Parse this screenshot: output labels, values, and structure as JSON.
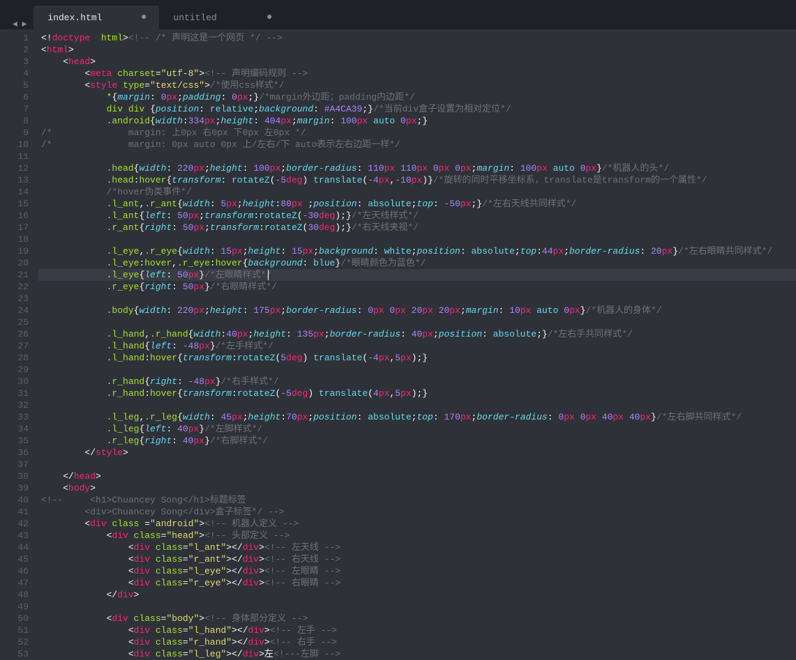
{
  "tabs": [
    {
      "label": "index.html",
      "active": true,
      "dirty": true
    },
    {
      "label": "untitled",
      "active": false,
      "dirty": true
    }
  ],
  "nav": {
    "back": "◄",
    "fwd": "►"
  },
  "line_count": 53,
  "active_line": 21,
  "code_lines": [
    "<span class='pun'>&lt;!</span><span class='kw'>doctype</span><span class='pun'>  </span><span class='attr'>html</span><span class='pun'>&gt;</span><span class='cmt'>&lt;!-- /* 声明这是一个网页 */ --&gt;</span>",
    "<span class='pun'>&lt;</span><span class='tag'>html</span><span class='pun'>&gt;</span>",
    "    <span class='pun'>&lt;</span><span class='tag'>head</span><span class='pun'>&gt;</span>",
    "        <span class='pun'>&lt;</span><span class='tag'>meta</span> <span class='attr'>charset</span><span class='pun'>=</span><span class='str'>\"utf-8\"</span><span class='pun'>&gt;</span><span class='cmt'>&lt;!-- 声明编码规则 --&gt;</span>",
    "        <span class='pun'>&lt;</span><span class='tag'>style</span> <span class='attr'>type</span><span class='pun'>=</span><span class='str'>\"text/css\"</span><span class='pun'>&gt;</span><span class='cmt'>/*使用css样式*/</span>",
    "            <span class='sel'>*</span><span class='pun'>{</span><span class='prop'>margin</span><span class='pun'>: </span><span class='num'>0</span><span class='unit'>px</span><span class='pun'>;</span><span class='prop'>padding</span><span class='pun'>: </span><span class='num'>0</span><span class='unit'>px</span><span class='pun'>;}</span><span class='cmt'>/*margin外边距；padding内边距*/</span>",
    "            <span class='sel'>div</span> <span class='sel'>div</span> <span class='pun'>{</span><span class='prop'>position</span><span class='pun'>: </span><span class='val'>relative</span><span class='pun'>;</span><span class='prop'>background</span><span class='pun'>: </span><span class='hex'>#A4CA39</span><span class='pun'>;}</span><span class='cmt'>/*当前div盒子设置为相对定位*/</span>",
    "            <span class='sel'>.android</span><span class='pun'>{</span><span class='prop'>width</span><span class='pun'>:</span><span class='num'>334</span><span class='unit'>px</span><span class='pun'>;</span><span class='prop'>height</span><span class='pun'>: </span><span class='num'>404</span><span class='unit'>px</span><span class='pun'>;</span><span class='prop'>margin</span><span class='pun'>: </span><span class='num'>100</span><span class='unit'>px</span> <span class='val'>auto</span> <span class='num'>0</span><span class='unit'>px</span><span class='pun'>;}</span>",
    "<span class='cmt'>/*              margin: 上0px 右0px 下0px 左0px */</span>",
    "<span class='cmt'>/*              margin: 0px auto 0px 上/左右/下 auto表示左右边距一样*/</span>",
    "",
    "            <span class='sel'>.head</span><span class='pun'>{</span><span class='prop'>width</span><span class='pun'>: </span><span class='num'>220</span><span class='unit'>px</span><span class='pun'>;</span><span class='prop'>height</span><span class='pun'>: </span><span class='num'>100</span><span class='unit'>px</span><span class='pun'>;</span><span class='prop'>border-radius</span><span class='pun'>: </span><span class='num'>110</span><span class='unit'>px</span> <span class='num'>110</span><span class='unit'>px</span> <span class='num'>0</span><span class='unit'>px</span> <span class='num'>0</span><span class='unit'>px</span><span class='pun'>;</span><span class='prop'>margin</span><span class='pun'>: </span><span class='num'>100</span><span class='unit'>px</span> <span class='val'>auto</span> <span class='num'>0</span><span class='unit'>px</span><span class='pun'>}</span><span class='cmt'>/*机器人的头*/</span>",
    "            <span class='sel'>.head</span><span class='pun'>:</span><span class='sel'>hover</span><span class='pun'>{</span><span class='prop'>transform</span><span class='pun'>: </span><span class='fn'>rotateZ</span><span class='pun'>(</span><span class='num'>-5</span><span class='unit'>deg</span><span class='pun'>) </span><span class='fn'>translate</span><span class='pun'>(</span><span class='num'>-4</span><span class='unit'>px</span><span class='pun'>,</span><span class='num'>-10</span><span class='unit'>px</span><span class='pun'>)}</span><span class='cmt'>/*旋转的同时平移坐标系，translate是transform的一个属性*/</span>",
    "            <span class='cmt'>/*hover伪类事件*/</span>",
    "            <span class='sel'>.l_ant</span><span class='pun'>,</span><span class='sel'>.r_ant</span><span class='pun'>{</span><span class='prop'>width</span><span class='pun'>: </span><span class='num'>5</span><span class='unit'>px</span><span class='pun'>;</span><span class='prop'>height</span><span class='pun'>:</span><span class='num'>80</span><span class='unit'>px</span> <span class='pun'>;</span><span class='prop'>position</span><span class='pun'>: </span><span class='val'>absolute</span><span class='pun'>;</span><span class='prop'>top</span><span class='pun'>: </span><span class='num'>-50</span><span class='unit'>px</span><span class='pun'>;}</span><span class='cmt'>/*左右天线共同样式*/</span>",
    "            <span class='sel'>.l_ant</span><span class='pun'>{</span><span class='prop'>left</span><span class='pun'>: </span><span class='num'>50</span><span class='unit'>px</span><span class='pun'>;</span><span class='prop'>transform</span><span class='pun'>:</span><span class='fn'>rotateZ</span><span class='pun'>(</span><span class='num'>-30</span><span class='unit'>deg</span><span class='pun'>);}</span><span class='cmt'>/*左天线样式*/</span>",
    "            <span class='sel'>.r_ant</span><span class='pun'>{</span><span class='prop'>right</span><span class='pun'>: </span><span class='num'>50</span><span class='unit'>px</span><span class='pun'>;</span><span class='prop'>transform</span><span class='pun'>:</span><span class='fn'>rotateZ</span><span class='pun'>(</span><span class='num'>30</span><span class='unit'>deg</span><span class='pun'>);}</span><span class='cmt'>/*右天线夹视*/</span>",
    "",
    "            <span class='sel'>.l_eye</span><span class='pun'>,</span><span class='sel'>.r_eye</span><span class='pun'>{</span><span class='prop'>width</span><span class='pun'>: </span><span class='num'>15</span><span class='unit'>px</span><span class='pun'>;</span><span class='prop'>height</span><span class='pun'>: </span><span class='num'>15</span><span class='unit'>px</span><span class='pun'>;</span><span class='prop'>background</span><span class='pun'>: </span><span class='val'>white</span><span class='pun'>;</span><span class='prop'>position</span><span class='pun'>: </span><span class='val'>absolute</span><span class='pun'>;</span><span class='prop'>top</span><span class='pun'>:</span><span class='num'>44</span><span class='unit'>px</span><span class='pun'>;</span><span class='prop'>border-radius</span><span class='pun'>: </span><span class='num'>20</span><span class='unit'>px</span><span class='pun'>}</span><span class='cmt'>/*左右眼睛共同样式*/</span>",
    "            <span class='sel'>.l_eye</span><span class='pun'>:</span><span class='sel'>hover</span><span class='pun'>,</span><span class='sel'>.r_eye</span><span class='pun'>:</span><span class='sel'>hover</span><span class='pun'>{</span><span class='prop'>background</span><span class='pun'>: </span><span class='val'>blue</span><span class='pun'>}</span><span class='cmt'>/*眼睛颜色为蓝色*/</span>",
    "            <span class='sel'>.l_eye</span><span class='pun'>{</span><span class='prop'>left</span><span class='pun'>: </span><span class='num'>50</span><span class='unit'>px</span><span class='pun'>}</span><span class='cmt'>/*左眼睛样式*/</span>",
    "            <span class='sel'>.r_eye</span><span class='pun'>{</span><span class='prop'>right</span><span class='pun'>: </span><span class='num'>50</span><span class='unit'>px</span><span class='pun'>}</span><span class='cmt'>/*右眼睛样式*/</span>",
    "",
    "            <span class='sel'>.body</span><span class='pun'>{</span><span class='prop'>width</span><span class='pun'>: </span><span class='num'>220</span><span class='unit'>px</span><span class='pun'>;</span><span class='prop'>height</span><span class='pun'>: </span><span class='num'>175</span><span class='unit'>px</span><span class='pun'>;</span><span class='prop'>border-radius</span><span class='pun'>: </span><span class='num'>0</span><span class='unit'>px</span> <span class='num'>0</span><span class='unit'>px</span> <span class='num'>20</span><span class='unit'>px</span> <span class='num'>20</span><span class='unit'>px</span><span class='pun'>;</span><span class='prop'>margin</span><span class='pun'>: </span><span class='num'>10</span><span class='unit'>px</span> <span class='val'>auto</span> <span class='num'>0</span><span class='unit'>px</span><span class='pun'>}</span><span class='cmt'>/*机器人的身体*/</span>",
    "",
    "            <span class='sel'>.l_hand</span><span class='pun'>,</span><span class='sel'>.r_hand</span><span class='pun'>{</span><span class='prop'>width</span><span class='pun'>:</span><span class='num'>40</span><span class='unit'>px</span><span class='pun'>;</span><span class='prop'>height</span><span class='pun'>: </span><span class='num'>135</span><span class='unit'>px</span><span class='pun'>;</span><span class='prop'>border-radius</span><span class='pun'>: </span><span class='num'>40</span><span class='unit'>px</span><span class='pun'>;</span><span class='prop'>position</span><span class='pun'>: </span><span class='val'>absolute</span><span class='pun'>;}</span><span class='cmt'>/*左右手共同样式*/</span>",
    "            <span class='sel'>.l_hand</span><span class='pun'>{</span><span class='prop'>left</span><span class='pun'>: </span><span class='num'>-48</span><span class='unit'>px</span><span class='pun'>}</span><span class='cmt'>/*左手样式*/</span>",
    "            <span class='sel'>.l_hand</span><span class='pun'>:</span><span class='sel'>hover</span><span class='pun'>{</span><span class='prop'>transform</span><span class='pun'>:</span><span class='fn'>rotateZ</span><span class='pun'>(</span><span class='num'>5</span><span class='unit'>deg</span><span class='pun'>) </span><span class='fn'>translate</span><span class='pun'>(</span><span class='num'>-4</span><span class='unit'>px</span><span class='pun'>,</span><span class='num'>5</span><span class='unit'>px</span><span class='pun'>);}</span>",
    "",
    "            <span class='sel'>.r_hand</span><span class='pun'>{</span><span class='prop'>right</span><span class='pun'>: </span><span class='num'>-48</span><span class='unit'>px</span><span class='pun'>}</span><span class='cmt'>/*右手样式*/</span>",
    "            <span class='sel'>.r_hand</span><span class='pun'>:</span><span class='sel'>hover</span><span class='pun'>{</span><span class='prop'>transform</span><span class='pun'>:</span><span class='fn'>rotateZ</span><span class='pun'>(</span><span class='num'>-5</span><span class='unit'>deg</span><span class='pun'>) </span><span class='fn'>translate</span><span class='pun'>(</span><span class='num'>4</span><span class='unit'>px</span><span class='pun'>,</span><span class='num'>5</span><span class='unit'>px</span><span class='pun'>);}</span>",
    "",
    "            <span class='sel'>.l_leg</span><span class='pun'>,</span><span class='sel'>.r_leg</span><span class='pun'>{</span><span class='prop'>width</span><span class='pun'>: </span><span class='num'>45</span><span class='unit'>px</span><span class='pun'>;</span><span class='prop'>height</span><span class='pun'>:</span><span class='num'>70</span><span class='unit'>px</span><span class='pun'>;</span><span class='prop'>position</span><span class='pun'>: </span><span class='val'>absolute</span><span class='pun'>;</span><span class='prop'>top</span><span class='pun'>: </span><span class='num'>170</span><span class='unit'>px</span><span class='pun'>;</span><span class='prop'>border-radius</span><span class='pun'>: </span><span class='num'>0</span><span class='unit'>px</span> <span class='num'>0</span><span class='unit'>px</span> <span class='num'>40</span><span class='unit'>px</span> <span class='num'>40</span><span class='unit'>px</span><span class='pun'>}</span><span class='cmt'>/*左右脚共同样式*/</span>",
    "            <span class='sel'>.l_leg</span><span class='pun'>{</span><span class='prop'>left</span><span class='pun'>: </span><span class='num'>40</span><span class='unit'>px</span><span class='pun'>}</span><span class='cmt'>/*左脚样式*/</span>",
    "            <span class='sel'>.r_leg</span><span class='pun'>{</span><span class='prop'>right</span><span class='pun'>: </span><span class='num'>40</span><span class='unit'>px</span><span class='pun'>}</span><span class='cmt'>/*右脚样式*/</span>",
    "        <span class='pun'>&lt;/</span><span class='tag'>style</span><span class='pun'>&gt;</span>",
    "",
    "    <span class='pun'>&lt;/</span><span class='tag'>head</span><span class='pun'>&gt;</span>",
    "    <span class='pun'>&lt;</span><span class='tag'>body</span><span class='pun'>&gt;</span>",
    "<span class='cmt'>&lt;!--     &lt;h1&gt;Chuancey Song&lt;/h1&gt;标题标签</span>",
    "<span class='cmt'>        &lt;div&gt;Chuancey Song&lt;/div&gt;盒子标签*/ --&gt;</span>",
    "        <span class='pun'>&lt;</span><span class='tag'>div</span> <span class='attr'>class</span> <span class='pun'>=</span><span class='str'>\"android\"</span><span class='pun'>&gt;</span><span class='cmt'>&lt;!-- 机器人定义 --&gt;</span>",
    "            <span class='pun'>&lt;</span><span class='tag'>div</span> <span class='attr'>class</span><span class='pun'>=</span><span class='str'>\"head\"</span><span class='pun'>&gt;</span><span class='cmt'>&lt;!-- 头部定义 --&gt;</span>",
    "                <span class='pun'>&lt;</span><span class='tag'>div</span> <span class='attr'>class</span><span class='pun'>=</span><span class='str'>\"l_ant\"</span><span class='pun'>&gt;&lt;/</span><span class='tag'>div</span><span class='pun'>&gt;</span><span class='cmt'>&lt;!-- 左天线 --&gt;</span>",
    "                <span class='pun'>&lt;</span><span class='tag'>div</span> <span class='attr'>class</span><span class='pun'>=</span><span class='str'>\"r_ant\"</span><span class='pun'>&gt;&lt;/</span><span class='tag'>div</span><span class='pun'>&gt;</span><span class='cmt'>&lt;!-- 右天线 --&gt;</span>",
    "                <span class='pun'>&lt;</span><span class='tag'>div</span> <span class='attr'>class</span><span class='pun'>=</span><span class='str'>\"l_eye\"</span><span class='pun'>&gt;&lt;/</span><span class='tag'>div</span><span class='pun'>&gt;</span><span class='cmt'>&lt;!-- 左眼睛 --&gt;</span>",
    "                <span class='pun'>&lt;</span><span class='tag'>div</span> <span class='attr'>class</span><span class='pun'>=</span><span class='str'>\"r_eye\"</span><span class='pun'>&gt;&lt;/</span><span class='tag'>div</span><span class='pun'>&gt;</span><span class='cmt'>&lt;!-- 右眼睛 --&gt;</span>",
    "            <span class='pun'>&lt;/</span><span class='tag'>div</span><span class='pun'>&gt;</span>",
    "",
    "            <span class='pun'>&lt;</span><span class='tag'>div</span> <span class='attr'>class</span><span class='pun'>=</span><span class='str'>\"body\"</span><span class='pun'>&gt;</span><span class='cmt'>&lt;!-- 身体部分定义 --&gt;</span>",
    "                <span class='pun'>&lt;</span><span class='tag'>div</span> <span class='attr'>class</span><span class='pun'>=</span><span class='str'>\"l_hand\"</span><span class='pun'>&gt;&lt;/</span><span class='tag'>div</span><span class='pun'>&gt;</span><span class='cmt'>&lt;!-- 左手 --&gt;</span>",
    "                <span class='pun'>&lt;</span><span class='tag'>div</span> <span class='attr'>class</span><span class='pun'>=</span><span class='str'>\"r_hand\"</span><span class='pun'>&gt;&lt;/</span><span class='tag'>div</span><span class='pun'>&gt;</span><span class='cmt'>&lt;!-- 右手 --&gt;</span>",
    "                <span class='pun'>&lt;</span><span class='tag'>div</span> <span class='attr'>class</span><span class='pun'>=</span><span class='str'>\"l_leg\"</span><span class='pun'>&gt;&lt;/</span><span class='tag'>div</span><span class='pun'>&gt;</span><span class='txt'>左</span><span class='cmt'>&lt;!---左脚 --&gt;</span>"
  ]
}
